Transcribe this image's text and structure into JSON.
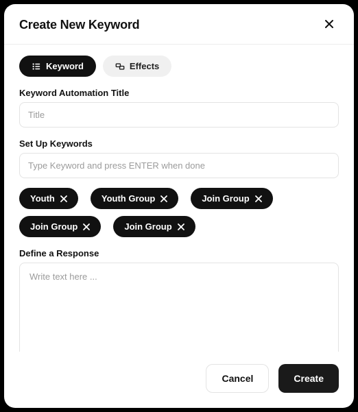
{
  "header": {
    "title": "Create New Keyword"
  },
  "tabs": {
    "keyword": {
      "label": "Keyword",
      "active": true
    },
    "effects": {
      "label": "Effects",
      "active": false
    }
  },
  "titleField": {
    "label": "Keyword Automation Title",
    "placeholder": "Title",
    "value": ""
  },
  "keywordsField": {
    "label": "Set Up Keywords",
    "placeholder": "Type Keyword and press ENTER when done",
    "value": ""
  },
  "chips": [
    {
      "label": "Youth"
    },
    {
      "label": "Youth Group"
    },
    {
      "label": "Join Group"
    },
    {
      "label": "Join Group"
    },
    {
      "label": "Join Group"
    }
  ],
  "responseField": {
    "label": "Define a Response",
    "placeholder": "Write text here ...",
    "value": ""
  },
  "toolbar": {
    "link_icon": "link-icon",
    "variable_icon": "variable-icon",
    "image_icon": "image-icon",
    "video_icon": "video-icon"
  },
  "footer": {
    "cancel": "Cancel",
    "create": "Create"
  }
}
